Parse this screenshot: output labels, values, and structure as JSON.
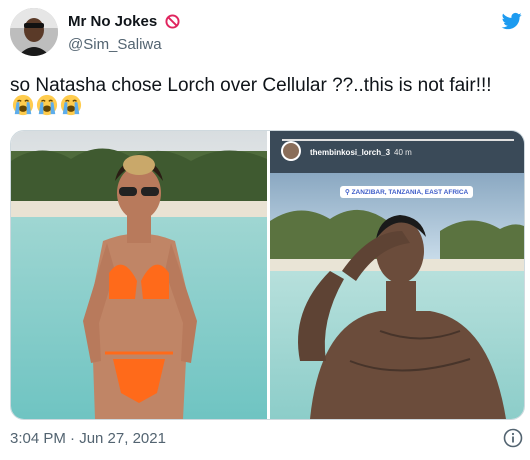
{
  "tweet": {
    "display_name": "Mr No Jokes",
    "handle": "@Sim_Saliwa",
    "text": "so Natasha chose Lorch over Cellular ??..this is not fair!!!",
    "emojis": [
      "loudly-crying-face",
      "loudly-crying-face",
      "loudly-crying-face"
    ],
    "timestamp": "3:04 PM · Jun 27, 2021",
    "verified_badge_icon": "no-entry-icon"
  },
  "media": {
    "right_photo": {
      "ig_username": "thembinkosi_lorch_3",
      "ig_time": "40 m",
      "location": "ZANZIBAR, TANZANIA, EAST AFRICA"
    }
  },
  "colors": {
    "twitter_blue": "#1d9bf0",
    "text_primary": "#0f1419",
    "text_secondary": "#536471",
    "border": "#cfd9de"
  }
}
